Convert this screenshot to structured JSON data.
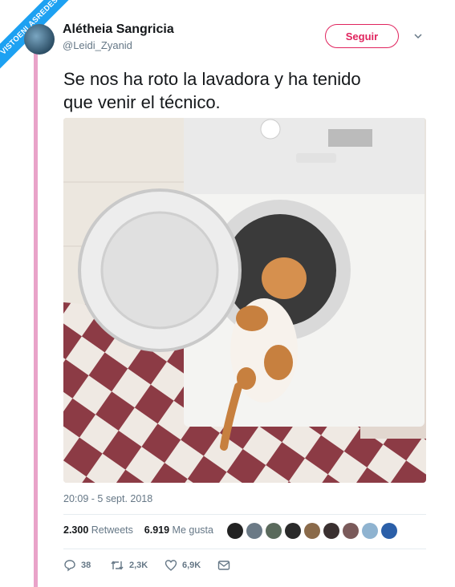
{
  "watermark": "VISTOENLASREDES",
  "tweet": {
    "author_name": "Alétheia Sangricia",
    "author_handle": "@Leidi_Zyanid",
    "follow_label": "Seguir",
    "text_line1": "Se nos ha roto la lavadora y ha tenido",
    "text_line2": "que venir el técnico.",
    "timestamp": "20:09 - 5 sept. 2018",
    "retweets_count": "2.300",
    "retweets_label": "Retweets",
    "likes_count": "6.919",
    "likes_label": "Me gusta",
    "reply_count": "38",
    "retweet_action_count": "2,3K",
    "like_action_count": "6,9K"
  },
  "colors": {
    "accent_pink": "#e0245e",
    "side_bar": "#e9a3c9",
    "ribbon": "#1da1f2",
    "muted": "#657786"
  }
}
